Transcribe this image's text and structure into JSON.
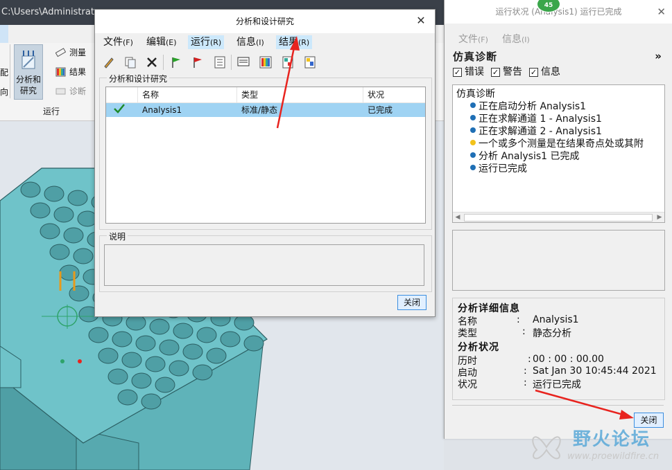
{
  "app": {
    "title": "C:\\Users\\Administrator",
    "ribbon": {
      "left_label_1": "配",
      "left_label_2": "向",
      "analysis_button": "分析和研究",
      "measure": "测量",
      "results": "结果",
      "diagnose": "诊断",
      "group_run": "运行"
    }
  },
  "dialog": {
    "title": "分析和设计研究",
    "menu": [
      {
        "label": "文件",
        "acc": "(F)"
      },
      {
        "label": "编辑",
        "acc": "(E)"
      },
      {
        "label": "运行",
        "acc": "(R)"
      },
      {
        "label": "信息",
        "acc": "(I)"
      },
      {
        "label": "结果",
        "acc": "(R)"
      }
    ],
    "toolbar_icons": [
      "pencil-icon",
      "copy-icon",
      "delete-icon",
      "green-flag-icon",
      "red-flag-icon",
      "checklist-icon",
      "monitor-icon",
      "results-icon",
      "compare-icon",
      "export-icon"
    ],
    "group_label": "分析和设计研究",
    "table": {
      "headers": [
        "名称",
        "类型",
        "状况"
      ],
      "rows": [
        {
          "name": "Analysis1",
          "type": "标准/静态",
          "status": "已完成"
        }
      ]
    },
    "desc_label": "说明",
    "close_label": "关闭"
  },
  "status_panel": {
    "title": "运行状况 (Analysis1) 运行已完成",
    "badge": "45",
    "menu": [
      {
        "label": "文件",
        "acc": "(F)"
      },
      {
        "label": "信息",
        "acc": "(I)"
      }
    ],
    "heading": "仿真诊断",
    "checkboxes": [
      "错误",
      "警告",
      "信息"
    ],
    "tree_root": "仿真诊断",
    "tree_items": [
      {
        "text": "正在启动分析 Analysis1",
        "color": "#1f6fb5"
      },
      {
        "text": "正在求解通道 1 - Analysis1",
        "color": "#1f6fb5"
      },
      {
        "text": "正在求解通道 2 - Analysis1",
        "color": "#1f6fb5"
      },
      {
        "text": "一个或多个测量是在结果奇点处或其附",
        "color": "#f2c21a"
      },
      {
        "text": "分析 Analysis1 已完成",
        "color": "#1f6fb5"
      },
      {
        "text": "运行已完成",
        "color": "#1f6fb5"
      }
    ],
    "details_heading": "分析详细信息",
    "name_key": "名称",
    "name_val": "Analysis1",
    "type_key": "类型",
    "type_val": "静态分析",
    "status_heading": "分析状况",
    "elapsed_key": "历时",
    "elapsed_val": "00 : 00 : 00.00",
    "start_key": "启动",
    "start_val": "Sat Jan 30 10:45:44 2021",
    "state_key": "状况",
    "state_val": "运行已完成",
    "close_label": "关闭"
  },
  "watermark": {
    "text": "野火论坛",
    "url": "www.proewildfire.cn"
  },
  "colors": {
    "selection": "#9fd3f3",
    "model": "#6fc3c9",
    "arrow": "#e8231e",
    "badge": "#3aa64a"
  }
}
